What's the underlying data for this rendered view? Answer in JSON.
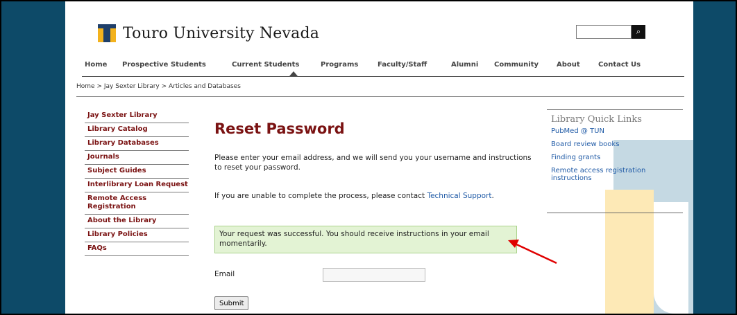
{
  "logo": {
    "text": "Touro University Nevada"
  },
  "search": {
    "button_icon": "⌕"
  },
  "nav": [
    "Home",
    "Prospective Students",
    "Current Students",
    "Programs",
    "Faculty/Staff",
    "Alumni",
    "Community",
    "About",
    "Contact Us"
  ],
  "breadcrumb": {
    "home": "Home",
    "library": "Jay Sexter Library",
    "current": "Articles and Databases",
    "sep": ">"
  },
  "sidebar": [
    "Jay Sexter Library",
    "Library Catalog",
    "Library Databases",
    "Journals",
    "Subject Guides",
    "Interlibrary Loan Request",
    "Remote Access Registration",
    "About the Library",
    "Library Policies",
    "FAQs"
  ],
  "main": {
    "title": "Reset Password",
    "intro": "Please enter your email address, and we will send you your username and instructions to reset your password.",
    "help_prefix": "If you are unable to complete the process, please contact ",
    "help_link": "Technical Support",
    "help_suffix": ".",
    "success": "Your request was successful. You should receive instructions in your email momentarily.",
    "email_label": "Email",
    "email_value": "",
    "submit": "Submit"
  },
  "quick_links": {
    "title": "Library Quick Links",
    "items": [
      "PubMed @ TUN",
      "Board review books",
      "Finding grants",
      "Remote access registration instructions"
    ]
  },
  "colors": {
    "frame": "#0d4a68",
    "accent": "#7a1212",
    "link": "#1f5aa6",
    "success_bg": "#e3f3d4",
    "arrow": "#e00000"
  }
}
